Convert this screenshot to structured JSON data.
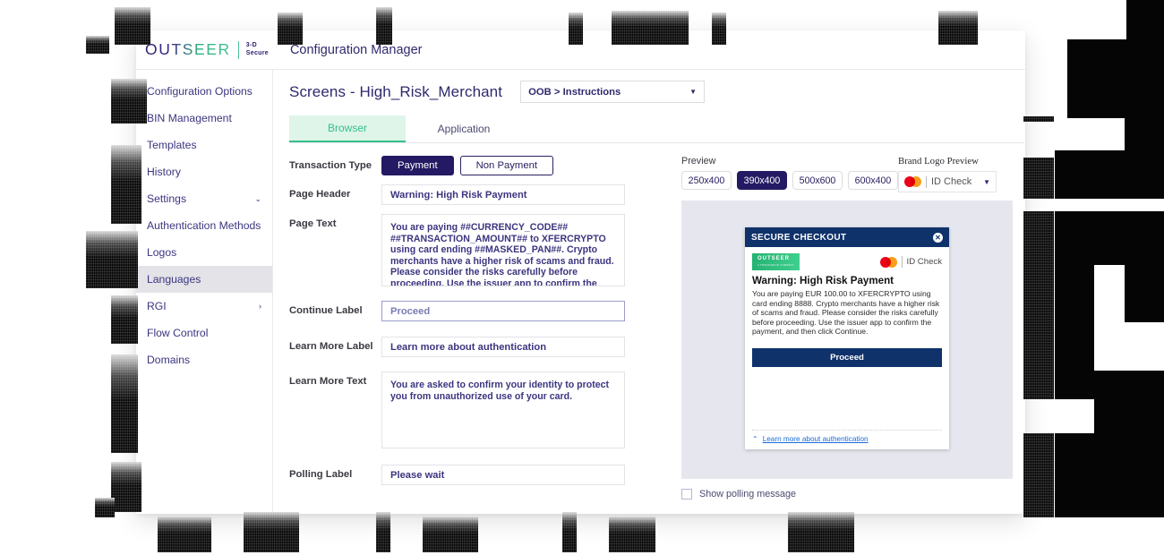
{
  "topbar": {
    "logo_word": "OUTSEER",
    "logo_sub_line1": "3-D",
    "logo_sub_line2": "Secure",
    "app_title": "Configuration Manager"
  },
  "sidebar": {
    "items": [
      {
        "label": "Configuration Options",
        "chevron": "",
        "active": false
      },
      {
        "label": "BIN Management",
        "chevron": "",
        "active": false
      },
      {
        "label": "Templates",
        "chevron": "",
        "active": false
      },
      {
        "label": "History",
        "chevron": "",
        "active": false
      },
      {
        "label": "Settings",
        "chevron": "⌄",
        "active": false
      },
      {
        "label": "Authentication Methods",
        "chevron": "",
        "active": false
      },
      {
        "label": "Logos",
        "chevron": "",
        "active": false
      },
      {
        "label": "Languages",
        "chevron": "",
        "active": true
      },
      {
        "label": "RGI",
        "chevron": "›",
        "active": false
      },
      {
        "label": "Flow Control",
        "chevron": "",
        "active": false
      },
      {
        "label": "Domains",
        "chevron": "",
        "active": false
      }
    ]
  },
  "main": {
    "page_title": "Screens - High_Risk_Merchant",
    "screen_select_value": "OOB > Instructions",
    "screen_select_caret": "▼",
    "tabs": [
      {
        "label": "Browser",
        "active": true
      },
      {
        "label": "Application",
        "active": false
      }
    ],
    "fields": {
      "transaction_type_label": "Transaction Type",
      "transaction_type_options": [
        {
          "label": "Payment",
          "selected": true
        },
        {
          "label": "Non Payment",
          "selected": false
        }
      ],
      "page_header_label": "Page Header",
      "page_header_value": "Warning: High Risk Payment",
      "page_text_label": "Page Text",
      "page_text_value": "You are paying ##CURRENCY_CODE## ##TRANSACTION_AMOUNT##  to XFERCRYPTO using card ending  ##MASKED_PAN##. Crypto merchants have a higher risk of scams and fraud. Please consider the risks carefully before proceeding. Use the issuer app to confirm the payment, and then click Continue.",
      "page_text_misspelled": "XFERCRYPTO",
      "continue_label_label": "Continue Label",
      "continue_label_value": "Proceed",
      "learn_more_label_label": "Learn More Label",
      "learn_more_label_value": "Learn more about authentication",
      "learn_more_text_label": "Learn More Text",
      "learn_more_text_value": "You are asked to confirm your identity to protect you from unauthorized use of your card.",
      "polling_label_label": "Polling Label",
      "polling_label_value": "Please wait"
    }
  },
  "preview": {
    "preview_label": "Preview",
    "brand_logo_label": "Brand Logo Preview",
    "sizes": [
      {
        "label": "250x400",
        "selected": false
      },
      {
        "label": "390x400",
        "selected": true
      },
      {
        "label": "500x600",
        "selected": false
      },
      {
        "label": "600x400",
        "selected": false
      }
    ],
    "brand_select_value": "ID Check",
    "brand_select_caret": "▼",
    "brand_icon": "mastercard-icon",
    "show_polling_label": "Show polling message",
    "show_polling_checked": false,
    "card": {
      "header_title": "SECURE CHECKOUT",
      "close_glyph": "✕",
      "badge_text": "OUTSEER",
      "badge_sub": "A TRANSUNION COMPANY",
      "brand_name": "ID Check",
      "title": "Warning: High Risk Payment",
      "body": "You are paying EUR 100.00 to XFERCRYPTO using card ending 8888. Crypto merchants have a higher risk of scams and fraud. Please consider the risks carefully before proceeding. Use the issuer app to confirm the payment, and then click Continue.",
      "button_label": "Proceed",
      "footer_caret": "⌃",
      "footer_link": "Learn more about authentication"
    }
  },
  "colors": {
    "brand_navy": "#241a63",
    "brand_green": "#35c08a",
    "card_navy": "#10326b",
    "accent_link": "#1a6bd6",
    "sidebar_active": "#e3e3e8",
    "stage_bg": "#e6e7ee"
  }
}
